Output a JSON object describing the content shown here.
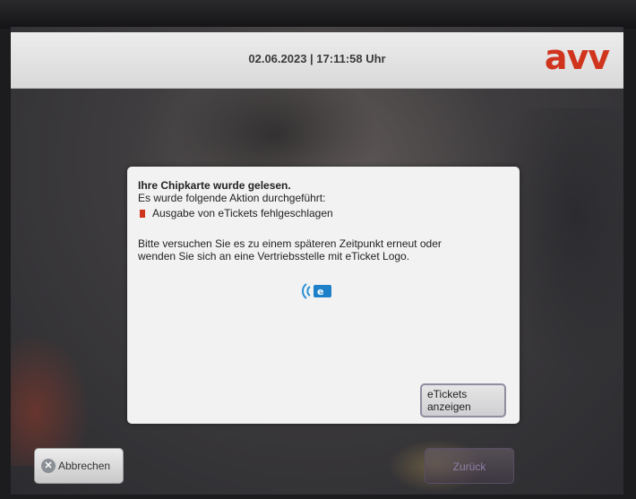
{
  "header": {
    "datetime": "02.06.2023 | 17:11:58 Uhr",
    "logo_text": "avv",
    "logo_color": "#d0341d"
  },
  "dialog": {
    "title": "Ihre Chipkarte wurde gelesen.",
    "subtitle": "Es wurde folgende Aktion durchgeführt:",
    "status_item": "Ausgabe von eTickets fehlgeschlagen",
    "status_color": "#d0341d",
    "instruction_line1": "Bitte versuchen Sie es zu einem späteren Zeitpunkt erneut oder",
    "instruction_line2": "wenden Sie sich an eine Vertriebsstelle mit eTicket Logo.",
    "icon": "eticket-logo-icon",
    "show_tickets_line1": "eTickets",
    "show_tickets_line2": "anzeigen"
  },
  "footer": {
    "cancel_label": "Abbrechen",
    "cancel_icon": "close-icon",
    "back_label": "Zurück"
  }
}
